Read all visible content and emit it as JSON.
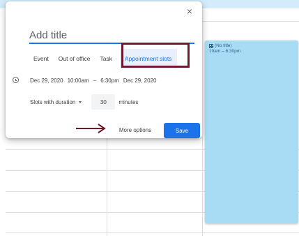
{
  "dialog": {
    "title_placeholder": "Add title",
    "tabs": [
      {
        "label": "Event"
      },
      {
        "label": "Out of office"
      },
      {
        "label": "Task"
      },
      {
        "label": "Appointment slots",
        "active": true
      }
    ],
    "datetime": {
      "start_date": "Dec 29, 2020",
      "start_time": "10:00am",
      "separator": "–",
      "end_time": "6:30pm",
      "end_date": "Dec 29, 2020"
    },
    "slots": {
      "mode_label": "Slots with duration",
      "duration_value": "30",
      "unit_label": "minutes"
    },
    "more_options_label": "More options",
    "save_label": "Save",
    "close_label": "×"
  },
  "calendar": {
    "event_block": {
      "title": "(No title)",
      "time_range": "10am – 6:30pm"
    }
  },
  "colors": {
    "accent": "#1a73e8",
    "annotation": "#6d1a2e",
    "event_fill": "#a8dcf5"
  },
  "icons": {
    "close": "close-icon",
    "clock": "clock-icon",
    "dropdown": "chevron-down-icon",
    "event_grid": "grid-icon",
    "annotation_arrow": "arrow-right-icon"
  }
}
